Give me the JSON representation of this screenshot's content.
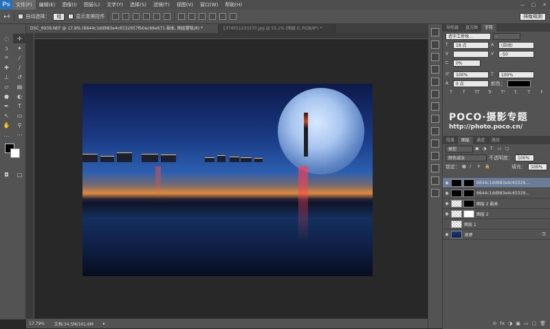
{
  "menu": {
    "logo": "Ps",
    "items": [
      "文件(F)",
      "编辑(E)",
      "图像(I)",
      "图层(L)",
      "文字(Y)",
      "选择(S)",
      "滤镜(T)",
      "视图(V)",
      "窗口(W)",
      "帮助(H)"
    ],
    "win": [
      "—",
      "□",
      "✕"
    ]
  },
  "options": {
    "auto_select_label": "自动选择：",
    "auto_select_value": "组",
    "show_transform_label": "显示变换控件",
    "workspace": "排版规则"
  },
  "tabs": [
    "DSC_6939.NEF @ 17.8% (6644c1dd983e4c6532957fb0ec66e671 副本, 图层蒙版/8) *",
    "1374551233370.jpg @ 55.1% (图层 0, RGB/8*) *"
  ],
  "status": {
    "zoom": "17.79%",
    "doc": "文档:34.5M/161.6M"
  },
  "panel": {
    "tabs": [
      "导航器",
      "直方图",
      "字符"
    ],
    "font_family": "造字工房悦...",
    "font_size": "18 点",
    "leading": "(自动)",
    "tracking": "-50",
    "scale": "0%",
    "vscale": "100%",
    "hscale": "100%",
    "baseline": "0 点",
    "color_label": "颜色：",
    "styles": [
      "T",
      "T",
      "TT",
      "Tr",
      "T¹",
      "T,",
      "T",
      "F"
    ]
  },
  "watermark": {
    "line1": "POCO·摄影专题",
    "line2": "http://photo.poco.cn/"
  },
  "layers": {
    "tabs": [
      "段落",
      "图层",
      "通道",
      "路径"
    ],
    "kind": "类型",
    "blend": "颜色减淡",
    "opacity_label": "不透明度：",
    "opacity": "100%",
    "lock_label": "锁定：",
    "fill_label": "填充：",
    "fill": "100%",
    "rows": [
      {
        "name": "6644c1dd983e4c65329...",
        "eye": "◉"
      },
      {
        "name": "6644c1dd983e4c65329...",
        "eye": "◉"
      },
      {
        "name": "图层 2 副本",
        "eye": "◉"
      },
      {
        "name": "图层 2",
        "eye": "◉"
      },
      {
        "name": "图层 1",
        "eye": ""
      },
      {
        "name": "背景",
        "eye": "◉"
      }
    ],
    "footer": [
      "⊝",
      "fx",
      "◑",
      "▣",
      "▭",
      "▢",
      "🗑"
    ]
  }
}
